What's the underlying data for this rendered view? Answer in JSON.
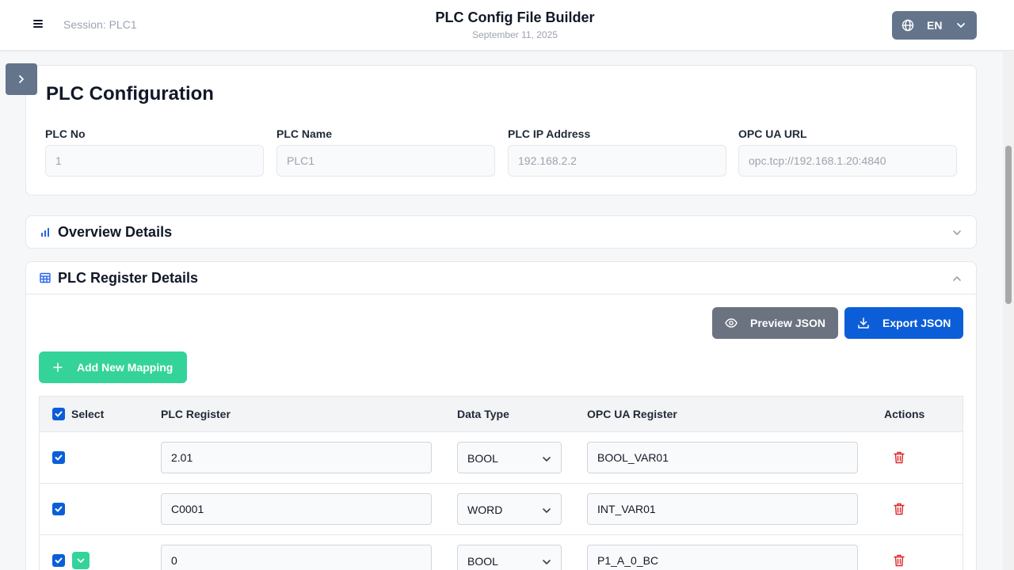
{
  "header": {
    "session": "Session: PLC1",
    "title": "PLC Config File Builder",
    "date": "September 11, 2025",
    "language": "EN"
  },
  "config": {
    "title": "PLC Configuration",
    "fields": [
      {
        "label": "PLC No",
        "value": "1"
      },
      {
        "label": "PLC Name",
        "value": "PLC1"
      },
      {
        "label": "PLC IP Address",
        "value": "192.168.2.2"
      },
      {
        "label": "OPC UA URL",
        "value": "opc.tcp://192.168.1.20:4840"
      }
    ]
  },
  "overview": {
    "title": "Overview Details"
  },
  "register": {
    "title": "PLC Register Details",
    "preview_label": "Preview JSON",
    "export_label": "Export JSON",
    "add_label": "Add New Mapping",
    "columns": {
      "select": "Select",
      "plc_register": "PLC Register",
      "data_type": "Data Type",
      "opc_register": "OPC UA Register",
      "actions": "Actions"
    },
    "rows": [
      {
        "plc_register": "2.01",
        "data_type": "BOOL",
        "opc_register": "BOOL_VAR01"
      },
      {
        "plc_register": "C0001",
        "data_type": "WORD",
        "opc_register": "INT_VAR01"
      },
      {
        "plc_register": "0",
        "data_type": "BOOL",
        "opc_register": "P1_A_0_BC"
      }
    ]
  },
  "colors": {
    "primary": "#0b5ed7",
    "secondary": "#6b7280",
    "success": "#34d399",
    "danger": "#dc2626"
  }
}
